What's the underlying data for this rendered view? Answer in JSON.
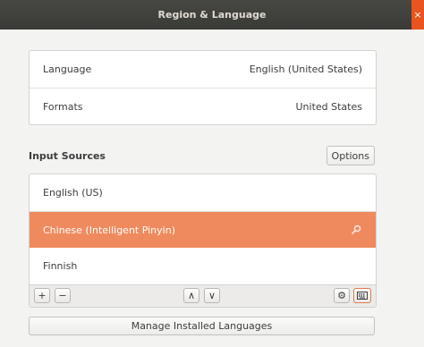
{
  "window": {
    "title": "Region & Language",
    "close_glyph": "×"
  },
  "language_card": {
    "language_label": "Language",
    "language_value": "English (United States)",
    "formats_label": "Formats",
    "formats_value": "United States"
  },
  "input_sources": {
    "title": "Input Sources",
    "options_label": "Options",
    "items": [
      {
        "label": "English (US)"
      },
      {
        "label": "Chinese (Intelligent Pinyin)",
        "selected": true
      },
      {
        "label": "Finnish"
      }
    ],
    "toolbar": {
      "add_glyph": "+",
      "remove_glyph": "−",
      "up_glyph": "∧",
      "down_glyph": "∨",
      "settings_glyph": "⚙",
      "icons": [
        "add-icon",
        "remove-icon",
        "move-up-icon",
        "move-down-icon",
        "settings-icon",
        "keyboard-icon"
      ]
    }
  },
  "manage_label": "Manage Installed Languages",
  "colors": {
    "titlebar": "#3c3b37",
    "selection": "#ef8a5e",
    "close": "#e95420"
  }
}
